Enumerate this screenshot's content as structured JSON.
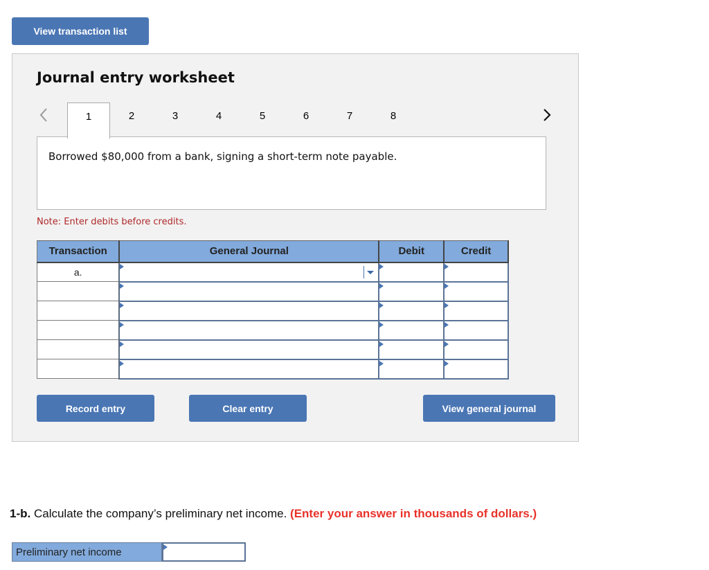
{
  "top_button": {
    "label": "View transaction list"
  },
  "worksheet": {
    "title": "Journal entry worksheet",
    "nav": {
      "prev_icon": "chevron-left-icon",
      "next_icon": "chevron-right-icon"
    },
    "tabs": [
      {
        "label": "1",
        "active": true
      },
      {
        "label": "2",
        "active": false
      },
      {
        "label": "3",
        "active": false
      },
      {
        "label": "4",
        "active": false
      },
      {
        "label": "5",
        "active": false
      },
      {
        "label": "6",
        "active": false
      },
      {
        "label": "7",
        "active": false
      },
      {
        "label": "8",
        "active": false
      }
    ],
    "description": "Borrowed $80,000 from a bank, signing a short-term note payable.",
    "note": "Note: Enter debits before credits.",
    "table": {
      "headers": {
        "transaction": "Transaction",
        "general_journal": "General Journal",
        "debit": "Debit",
        "credit": "Credit"
      },
      "rows": [
        {
          "transaction": "a.",
          "account": "",
          "debit": "",
          "credit": ""
        },
        {
          "transaction": "",
          "account": "",
          "debit": "",
          "credit": ""
        },
        {
          "transaction": "",
          "account": "",
          "debit": "",
          "credit": ""
        },
        {
          "transaction": "",
          "account": "",
          "debit": "",
          "credit": ""
        },
        {
          "transaction": "",
          "account": "",
          "debit": "",
          "credit": ""
        },
        {
          "transaction": "",
          "account": "",
          "debit": "",
          "credit": ""
        }
      ]
    },
    "buttons": {
      "record": "Record entry",
      "clear": "Clear entry",
      "view_journal": "View general journal"
    }
  },
  "question": {
    "number": "1-b.",
    "text": " Calculate the company’s preliminary net income. ",
    "instruction": "(Enter your answer in thousands of dollars.)",
    "field_label": "Preliminary net income",
    "field_value": ""
  },
  "colors": {
    "button": "#4a76b4",
    "header": "#82aadc",
    "note": "#b0282a",
    "instruction": "#e8322a"
  }
}
